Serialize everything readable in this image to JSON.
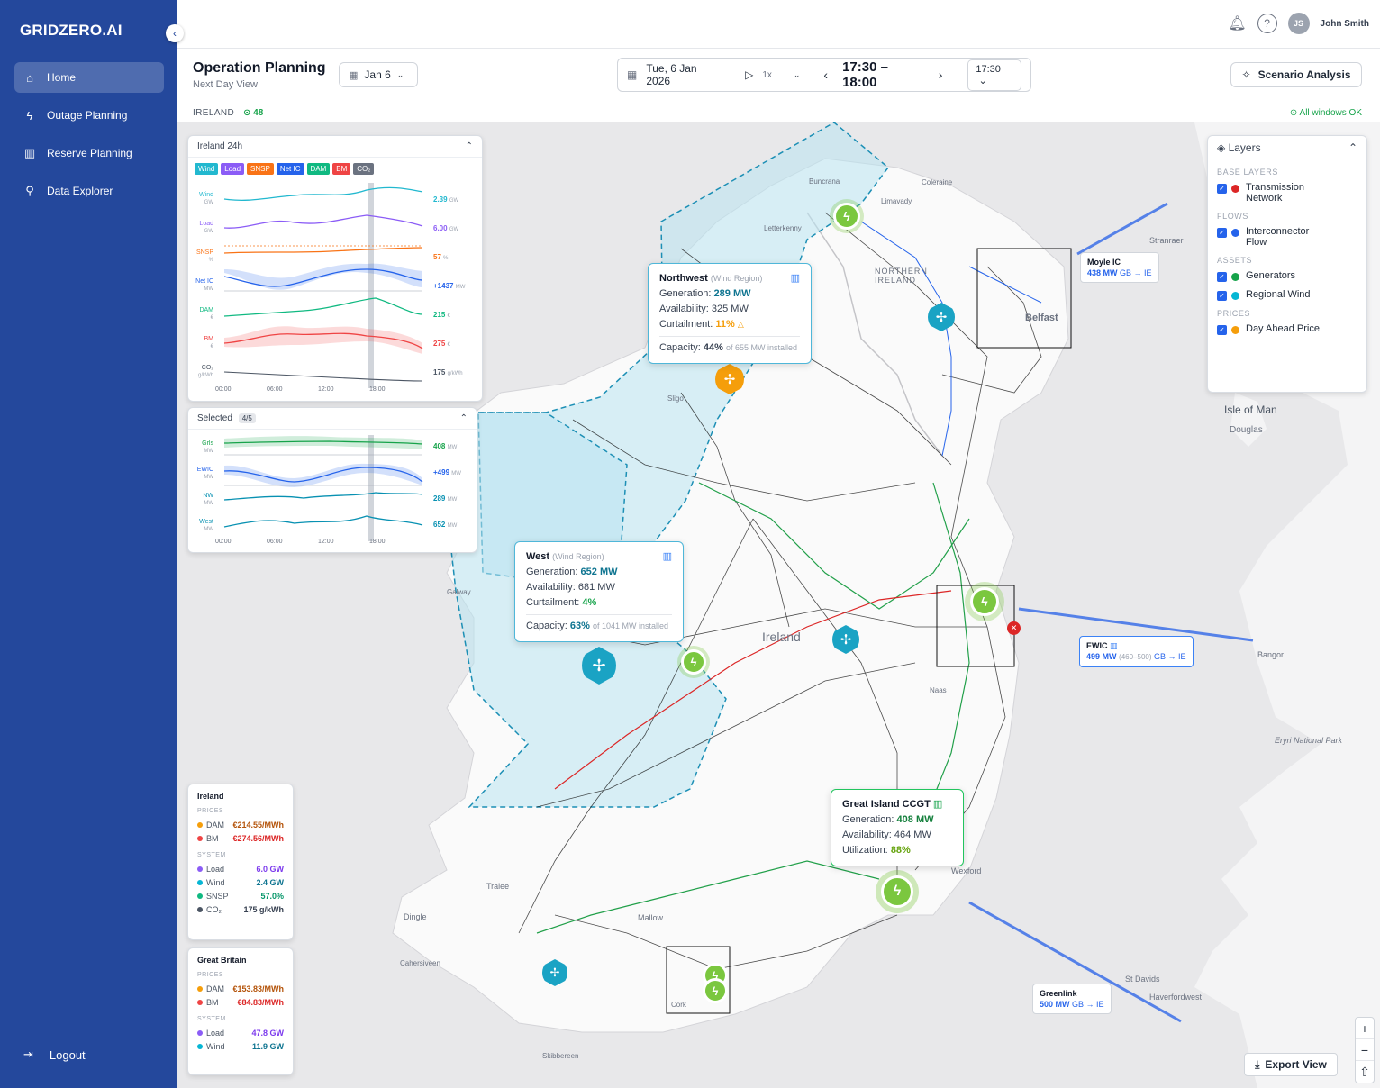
{
  "app": {
    "brand": "GRIDZERO.AI",
    "collapse_icon": "‹"
  },
  "nav": [
    {
      "label": "Home",
      "icon": "⌂",
      "active": true
    },
    {
      "label": "Outage Planning",
      "icon": "ϟ",
      "active": false
    },
    {
      "label": "Reserve Planning",
      "icon": "▥",
      "active": false
    },
    {
      "label": "Data Explorer",
      "icon": "⚲",
      "active": false
    }
  ],
  "logout": {
    "label": "Logout",
    "icon": "⇥"
  },
  "user": {
    "initials": "JS",
    "name": "John Smith"
  },
  "page": {
    "title": "Operation Planning",
    "subtitle": "Next Day View",
    "day": "Jan 6"
  },
  "timebar": {
    "date": "Tue, 6 Jan 2026",
    "speed": "1x",
    "range": "17:30 – 18:00",
    "slot": "17:30"
  },
  "scenario_button": "Scenario Analysis",
  "strip": {
    "region": "IRELAND",
    "count": "48",
    "status": "All windows OK"
  },
  "ireland24": {
    "title": "Ireland 24h",
    "chips": [
      {
        "label": "Wind",
        "color": "#22b8cf"
      },
      {
        "label": "Load",
        "color": "#8b5cf6"
      },
      {
        "label": "SNSP",
        "color": "#f97316"
      },
      {
        "label": "Net IC",
        "color": "#2563eb"
      },
      {
        "label": "DAM",
        "color": "#10b981"
      },
      {
        "label": "BM",
        "color": "#ef4444"
      },
      {
        "label": "CO₂",
        "color": "#6b7280"
      }
    ],
    "rows": [
      {
        "name": "Wind",
        "unit": "GW",
        "value": "2.39",
        "vunit": "GW",
        "color": "#22b8cf"
      },
      {
        "name": "Load",
        "unit": "GW",
        "value": "6.00",
        "vunit": "GW",
        "color": "#8b5cf6"
      },
      {
        "name": "SNSP",
        "unit": "%",
        "value": "57",
        "vunit": "%",
        "color": "#f97316"
      },
      {
        "name": "Net IC",
        "unit": "MW",
        "value": "+1437",
        "vunit": "MW",
        "color": "#2563eb"
      },
      {
        "name": "DAM",
        "unit": "€",
        "value": "215",
        "vunit": "€",
        "color": "#10b981"
      },
      {
        "name": "BM",
        "unit": "€",
        "value": "275",
        "vunit": "€",
        "color": "#ef4444"
      },
      {
        "name": "CO₂",
        "unit": "g/kWh",
        "value": "175",
        "vunit": "g/kWh",
        "color": "#4b5563"
      }
    ],
    "xticks": [
      "00:00",
      "06:00",
      "12:00",
      "18:00"
    ]
  },
  "selected": {
    "title": "Selected",
    "count": "4/5",
    "rows": [
      {
        "name": "Grls",
        "unit": "MW",
        "value": "408",
        "vunit": "MW",
        "color": "#16a34a"
      },
      {
        "name": "EWIC",
        "unit": "MW",
        "value": "+499",
        "vunit": "MW",
        "color": "#2563eb"
      },
      {
        "name": "NW",
        "unit": "MW",
        "value": "289",
        "vunit": "MW",
        "color": "#0891b2"
      },
      {
        "name": "West",
        "unit": "MW",
        "value": "652",
        "vunit": "MW",
        "color": "#0891b2"
      }
    ],
    "xticks": [
      "00:00",
      "06:00",
      "12:00",
      "18:00"
    ]
  },
  "tooltips": {
    "northwest": {
      "name": "Northwest",
      "kind": "(Wind Region)",
      "gen_label": "Generation:",
      "gen": "289 MW",
      "avail_label": "Availability:",
      "avail": "325 MW",
      "curt_label": "Curtailment:",
      "curt": "11%",
      "cap_label": "Capacity:",
      "cap": "44%",
      "installed": "of 655 MW installed"
    },
    "west": {
      "name": "West",
      "kind": "(Wind Region)",
      "gen_label": "Generation:",
      "gen": "652 MW",
      "avail_label": "Availability:",
      "avail": "681 MW",
      "curt_label": "Curtailment:",
      "curt": "4%",
      "cap_label": "Capacity:",
      "cap": "63%",
      "installed": "of 1041 MW installed"
    },
    "greatisland": {
      "name": "Great Island CCGT",
      "gen_label": "Generation:",
      "gen": "408 MW",
      "avail_label": "Availability:",
      "avail": "464 MW",
      "util_label": "Utilization:",
      "util": "88%"
    }
  },
  "interconnectors": [
    {
      "name": "Moyle IC",
      "mw": "438 MW",
      "dir": "GB → IE"
    },
    {
      "name": "EWIC",
      "mw": "499 MW",
      "extra": "(460–500)",
      "dir": "GB → IE"
    },
    {
      "name": "Greenlink",
      "mw": "500 MW",
      "dir": "GB → IE"
    }
  ],
  "layers": {
    "title": "Layers",
    "sections": [
      {
        "name": "BASE LAYERS",
        "items": [
          {
            "label": "Transmission Network",
            "color": "#dc2626"
          }
        ]
      },
      {
        "name": "FLOWS",
        "items": [
          {
            "label": "Interconnector Flow",
            "color": "#2563eb"
          }
        ]
      },
      {
        "name": "ASSETS",
        "items": [
          {
            "label": "Generators",
            "color": "#16a34a"
          },
          {
            "label": "Regional Wind",
            "color": "#06b6d4"
          }
        ]
      },
      {
        "name": "PRICES",
        "items": [
          {
            "label": "Day Ahead Price",
            "color": "#f59e0b"
          }
        ]
      }
    ]
  },
  "ireland_summary": {
    "title": "Ireland",
    "prices_label": "PRICES",
    "prices": [
      {
        "label": "DAM",
        "value": "€214.55/MWh",
        "color": "#f59e0b"
      },
      {
        "label": "BM",
        "value": "€274.56/MWh",
        "color": "#ef4444"
      }
    ],
    "system_label": "SYSTEM",
    "system": [
      {
        "label": "Load",
        "value": "6.0 GW",
        "color": "#8b5cf6"
      },
      {
        "label": "Wind",
        "value": "2.4 GW",
        "color": "#06b6d4"
      },
      {
        "label": "SNSP",
        "value": "57.0%",
        "color": "#10b981"
      },
      {
        "label": "CO₂",
        "value": "175 g/kWh",
        "color": "#4b5563"
      }
    ]
  },
  "gb_summary": {
    "title": "Great Britain",
    "prices_label": "PRICES",
    "prices": [
      {
        "label": "DAM",
        "value": "€153.83/MWh",
        "color": "#f59e0b"
      },
      {
        "label": "BM",
        "value": "€84.83/MWh",
        "color": "#ef4444"
      }
    ],
    "system_label": "SYSTEM",
    "system": [
      {
        "label": "Load",
        "value": "47.8 GW",
        "color": "#8b5cf6"
      },
      {
        "label": "Wind",
        "value": "11.9 GW",
        "color": "#06b6d4"
      }
    ]
  },
  "map_labels": {
    "ireland": "Ireland",
    "northern_ireland": "NORTHERN IRELAND",
    "belfast": "Belfast",
    "isle_of_man": "Isle of Man",
    "douglas": "Douglas",
    "stranraer": "Stranraer",
    "letterkenny": "Letterkenny",
    "buncrana": "Buncrana",
    "sligo": "Sligo",
    "tralee": "Tralee",
    "dingle": "Dingle",
    "cork": "Cork",
    "wexford": "Wexford",
    "bangor": "Bangor",
    "st_davids": "St Davids",
    "haverfordwest": "Haverfordwest",
    "eryri": "Eryri National Park",
    "skibbereen": "Skibbereen",
    "mallow": "Mallow",
    "cahersiveen": "Cahersiveen",
    "coleraine": "Coleraine",
    "limavady": "Limavady",
    "galway": "Galway",
    "naas": "Naas"
  },
  "export_label": "Export View",
  "zoom": {
    "in": "+",
    "out": "−",
    "reset": "⇧"
  }
}
